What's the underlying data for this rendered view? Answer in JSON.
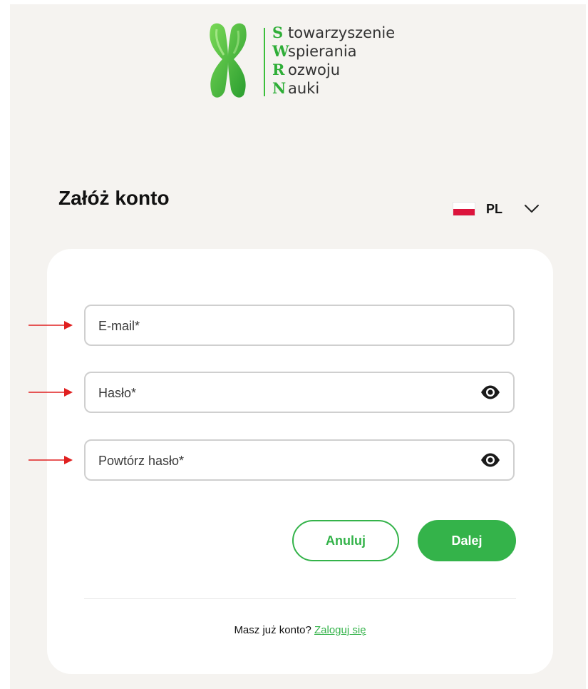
{
  "logo": {
    "lines": [
      {
        "initial": "S",
        "rest": "towarzyszenie"
      },
      {
        "initial": "W",
        "rest": "spierania"
      },
      {
        "initial": "R",
        "rest": "ozwoju"
      },
      {
        "initial": "N",
        "rest": "auki"
      }
    ],
    "mark_icon": "chromosome-icon",
    "brand_color": "#2fae38"
  },
  "header": {
    "title": "Załóż konto",
    "language": {
      "code": "PL",
      "flag": "poland-flag-icon",
      "chevron": "chevron-down-icon"
    }
  },
  "form": {
    "email": {
      "placeholder": "E-mail*",
      "value": ""
    },
    "password": {
      "placeholder": "Hasło*",
      "value": "",
      "toggle_icon": "eye-icon"
    },
    "repeat_password": {
      "placeholder": "Powtórz hasło*",
      "value": "",
      "toggle_icon": "eye-icon"
    },
    "cancel_label": "Anuluj",
    "next_label": "Dalej"
  },
  "footer": {
    "prompt": "Masz już konto?",
    "login_link": "Zaloguj się"
  },
  "colors": {
    "accent": "#34b34a",
    "background": "#f5f3f0",
    "annotation_arrow": "#e02020"
  }
}
